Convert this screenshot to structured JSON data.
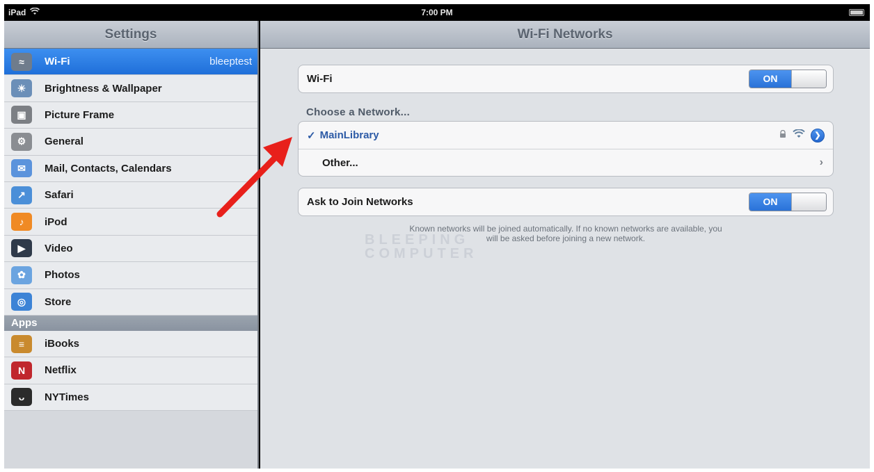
{
  "status_bar": {
    "device": "iPad",
    "time": "7:00 PM"
  },
  "sidebar": {
    "title": "Settings",
    "items": [
      {
        "label": "Wi-Fi",
        "detail": "bleeptest",
        "icon": "wifi-icon",
        "color": "#6f7c8c",
        "selected": true
      },
      {
        "label": "Brightness & Wallpaper",
        "icon": "brightness-icon",
        "color": "#6b8fb8"
      },
      {
        "label": "Picture Frame",
        "icon": "picture-frame-icon",
        "color": "#7c7f84"
      },
      {
        "label": "General",
        "icon": "gear-icon",
        "color": "#8a8d92"
      },
      {
        "label": "Mail, Contacts, Calendars",
        "icon": "mail-icon",
        "color": "#5b93dc"
      },
      {
        "label": "Safari",
        "icon": "safari-icon",
        "color": "#4b8fd8"
      },
      {
        "label": "iPod",
        "icon": "ipod-icon",
        "color": "#f08a24"
      },
      {
        "label": "Video",
        "icon": "video-icon",
        "color": "#2f3a4a"
      },
      {
        "label": "Photos",
        "icon": "photos-icon",
        "color": "#6ba4e0"
      },
      {
        "label": "Store",
        "icon": "store-icon",
        "color": "#3c83d6"
      }
    ],
    "apps_header": "Apps",
    "apps": [
      {
        "label": "iBooks",
        "icon": "ibooks-icon",
        "color": "#c98a2e"
      },
      {
        "label": "Netflix",
        "icon": "netflix-icon",
        "color": "#c0272d"
      },
      {
        "label": "NYTimes",
        "icon": "nytimes-icon",
        "color": "#2b2b2b"
      }
    ]
  },
  "detail": {
    "title": "Wi-Fi Networks",
    "wifi_label": "Wi-Fi",
    "wifi_toggle": "ON",
    "choose_label": "Choose a Network...",
    "networks": [
      {
        "name": "MainLibrary",
        "checked": true,
        "check": "✓"
      },
      {
        "name": "Other..."
      }
    ],
    "ask_label": "Ask to Join Networks",
    "ask_toggle": "ON",
    "footnote_line1": "Known networks will be joined automatically.  If no known networks are available, you",
    "footnote_line2": "will be asked before joining a new network.",
    "watermark_line1": "BLEEPING",
    "watermark_line2": "COMPUTER"
  },
  "colors": {
    "accent": "#2a72d8",
    "arrow": "#e8201b"
  }
}
